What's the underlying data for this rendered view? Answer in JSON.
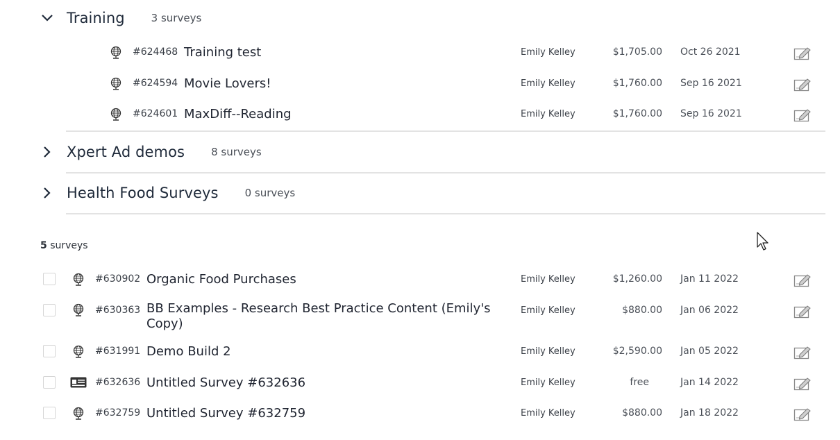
{
  "folders": [
    {
      "name": "Training",
      "count": "3 surveys",
      "expanded": true
    },
    {
      "name": "Xpert Ad demos",
      "count": "8 surveys",
      "expanded": false
    },
    {
      "name": "Health Food Surveys",
      "count": "0 surveys",
      "expanded": false
    }
  ],
  "training_surveys": [
    {
      "icon": "globe-icon",
      "id": "#624468",
      "name": "Training test",
      "owner": "Emily Kelley",
      "price": "$1,705.00",
      "date": "Oct 26 2021"
    },
    {
      "icon": "globe-icon",
      "id": "#624594",
      "name": "Movie Lovers!",
      "owner": "Emily Kelley",
      "price": "$1,760.00",
      "date": "Sep 16 2021"
    },
    {
      "icon": "globe-icon",
      "id": "#624601",
      "name": "MaxDiff--Reading",
      "owner": "Emily Kelley",
      "price": "$1,760.00",
      "date": "Sep 16 2021"
    }
  ],
  "summary": {
    "count": "5",
    "label": " surveys"
  },
  "surveys": [
    {
      "icon": "globe-icon",
      "id": "#630902",
      "name": "Organic Food Purchases",
      "owner": "Emily Kelley",
      "price": "$1,260.00",
      "date": "Jan 11 2022"
    },
    {
      "icon": "globe-icon",
      "id": "#630363",
      "name": "BB Examples - Research Best Practice Content (Emily's Copy)",
      "owner": "Emily Kelley",
      "price": "$880.00",
      "date": "Jan 06 2022"
    },
    {
      "icon": "globe-icon",
      "id": "#631991",
      "name": "Demo Build 2",
      "owner": "Emily Kelley",
      "price": "$2,590.00",
      "date": "Jan 05 2022"
    },
    {
      "icon": "id-card-icon",
      "id": "#632636",
      "name": "Untitled Survey #632636",
      "owner": "Emily Kelley",
      "price": "free",
      "date": "Jan 14 2022"
    },
    {
      "icon": "globe-icon",
      "id": "#632759",
      "name": "Untitled Survey #632759",
      "owner": "Emily Kelley",
      "price": "$880.00",
      "date": "Jan 18 2022"
    }
  ]
}
